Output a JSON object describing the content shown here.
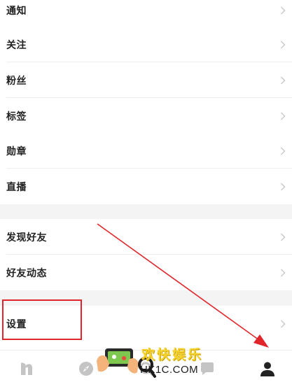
{
  "menu": {
    "group1": [
      {
        "label": "通知"
      },
      {
        "label": "关注"
      },
      {
        "label": "粉丝"
      },
      {
        "label": "标签"
      },
      {
        "label": "勋章"
      },
      {
        "label": "直播"
      }
    ],
    "group2": [
      {
        "label": "发现好友"
      },
      {
        "label": "好友动态"
      }
    ],
    "group3": [
      {
        "label": "设置"
      }
    ]
  },
  "tabbar": {
    "items": [
      {
        "icon": "home-n-icon"
      },
      {
        "icon": "compass-icon"
      },
      {
        "icon": "search-icon"
      },
      {
        "icon": "message-icon"
      },
      {
        "icon": "profile-icon"
      }
    ],
    "active_color": "#222222",
    "inactive_color": "#c4c4c4"
  },
  "annotation": {
    "color": "#e0262a"
  },
  "watermark": {
    "title": "欢快娱乐",
    "url": "HK1C.COM"
  }
}
